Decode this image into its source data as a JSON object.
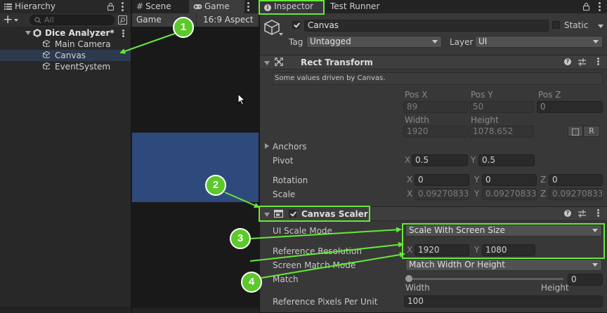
{
  "hierarchy": {
    "tab_label": "Hierarchy",
    "add_label": "+",
    "search_placeholder": "All",
    "scene_name": "Dice Analyzer*",
    "items": [
      {
        "label": "Main Camera"
      },
      {
        "label": "Canvas",
        "selected": true
      },
      {
        "label": "EventSystem"
      }
    ]
  },
  "scene_tabs": {
    "scene_label": "Scene",
    "game_label": "Game",
    "game_display": "Game",
    "aspect": "16:9 Aspect"
  },
  "inspector": {
    "tab_label": "Inspector",
    "test_runner_label": "Test Runner",
    "object_name": "Canvas",
    "static_label": "Static",
    "tag_label": "Tag",
    "tag_value": "Untagged",
    "layer_label": "Layer",
    "layer_value": "UI",
    "rect_transform": {
      "title": "Rect Transform",
      "driven_note": "Some values driven by Canvas.",
      "pos_x_label": "Pos X",
      "pos_x": "89",
      "pos_y_label": "Pos Y",
      "pos_y": "50",
      "pos_z_label": "Pos Z",
      "pos_z": "0",
      "width_label": "Width",
      "width": "1920",
      "height_label": "Height",
      "height": "1078.652",
      "raw_label": "R",
      "anchors_label": "Anchors",
      "pivot_label": "Pivot",
      "pivot_x": "0.5",
      "pivot_y": "0.5",
      "rotation_label": "Rotation",
      "rot_x": "0",
      "rot_y": "0",
      "rot_z": "0",
      "scale_label": "Scale",
      "scale_x": "0.09270833",
      "scale_y": "0.09270833",
      "scale_z": "0.09270833"
    },
    "canvas_scaler": {
      "title": "Canvas Scaler",
      "ui_scale_mode_label": "UI Scale Mode",
      "ui_scale_mode": "Scale With Screen Size",
      "ref_res_label": "Reference Resolution",
      "ref_x": "1920",
      "ref_y": "1080",
      "screen_match_label": "Screen Match Mode",
      "screen_match": "Match Width Or Height",
      "match_label": "Match",
      "match_value": "0",
      "slider_left": "Width",
      "slider_right": "Height",
      "ref_ppu_label": "Reference Pixels Per Unit",
      "ref_ppu": "100"
    },
    "axis": {
      "x": "X",
      "y": "Y",
      "z": "Z"
    }
  },
  "annotations": [
    "1",
    "2",
    "3",
    "4"
  ],
  "colors": {
    "highlight": "#67e73a",
    "badge": "#5cc92a",
    "game_view_blue": "#2e4a7c"
  }
}
